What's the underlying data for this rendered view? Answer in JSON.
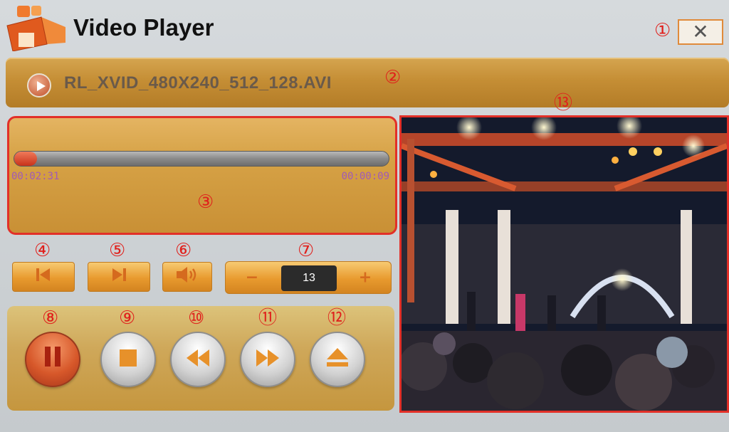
{
  "window": {
    "title": "Video Player",
    "close_label": "✕"
  },
  "file": {
    "name": "RL_XVID_480X240_512_128.AVI"
  },
  "progress": {
    "elapsed": "00:02:31",
    "remaining": "00:00:09",
    "fraction": 0.06
  },
  "controls": {
    "volume_value": "13",
    "volume_minus": "−",
    "volume_plus": "+"
  },
  "callouts": [
    "①",
    "②",
    "③",
    "④",
    "⑤",
    "⑥",
    "⑦",
    "⑧",
    "⑨",
    "⑩",
    "⑪",
    "⑫",
    "⑬"
  ],
  "icons": {
    "app": "video-camera-icon",
    "file": "play-circle-icon",
    "prev": "skip-previous-icon",
    "next": "skip-next-icon",
    "volume": "speaker-icon",
    "pause": "pause-icon",
    "stop": "stop-icon",
    "rewind": "rewind-icon",
    "forward": "fast-forward-icon",
    "eject": "eject-icon"
  },
  "colors": {
    "accent": "#d6a246",
    "callout": "#e0201c",
    "time_text": "#a05ab8"
  }
}
